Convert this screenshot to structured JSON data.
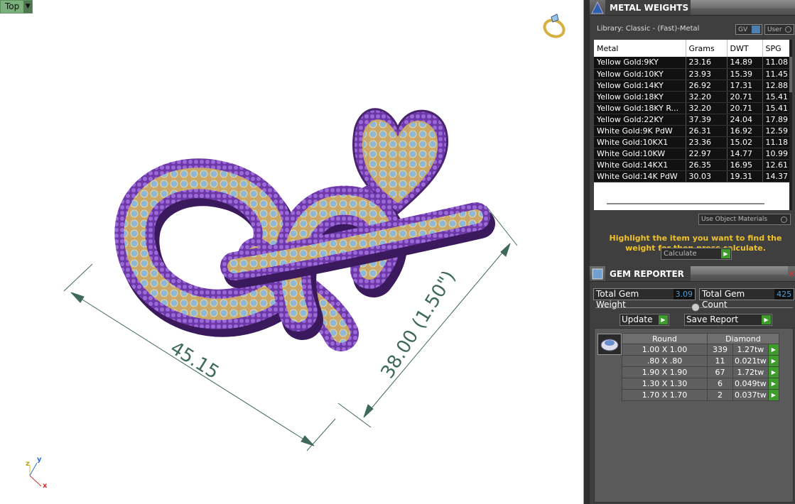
{
  "viewport": {
    "view_label": "Top",
    "dimension_horizontal": "45.15",
    "dimension_vertical": "38.00  (1.50\")",
    "axis_x": "x",
    "axis_y": "y",
    "axis_z": "z"
  },
  "metal_weights": {
    "title": "METAL WEIGHTS",
    "library": "Library: Classic - (Fast)-Metal",
    "gv_label": "GV",
    "user_label": "User",
    "columns": [
      "Metal",
      "Grams",
      "DWT",
      "SPG"
    ],
    "rows": [
      [
        "Yellow Gold:9KY",
        "23.16",
        "14.89",
        "11.08"
      ],
      [
        "Yellow Gold:10KY",
        "23.93",
        "15.39",
        "11.45"
      ],
      [
        "Yellow Gold:14KY",
        "26.92",
        "17.31",
        "12.88"
      ],
      [
        "Yellow Gold:18KY",
        "32.20",
        "20.71",
        "15.41"
      ],
      [
        "Yellow Gold:18KY R...",
        "32.20",
        "20.71",
        "15.41"
      ],
      [
        "Yellow Gold:22KY",
        "37.39",
        "24.04",
        "17.89"
      ],
      [
        "White Gold:9K PdW",
        "26.31",
        "16.92",
        "12.59"
      ],
      [
        "White Gold:10KX1",
        "23.36",
        "15.02",
        "11.18"
      ],
      [
        "White Gold:10KW",
        "22.97",
        "14.77",
        "10.99"
      ],
      [
        "White Gold:14KX1",
        "26.35",
        "16.95",
        "12.61"
      ],
      [
        "White Gold:14K PdW",
        "30.03",
        "19.31",
        "14.37"
      ]
    ],
    "use_object_materials": "Use Object Materials",
    "hint": "Highlight the item you want to find the weight for then press calculate.",
    "calculate_label": "Calculate"
  },
  "gem_reporter": {
    "title": "GEM REPORTER",
    "total_weight_label": "Total Gem Weight",
    "total_weight_value": "3.09",
    "total_count_label": "Total Gem Count",
    "total_count_value": "425",
    "update_label": "Update",
    "save_report_label": "Save Report",
    "shape_header": "Round",
    "stone_header": "Diamond",
    "rows": [
      [
        "1.00 X 1.00",
        "339",
        "1.27tw"
      ],
      [
        ".80 X .80",
        "11",
        "0.021tw"
      ],
      [
        "1.90 X 1.90",
        "67",
        "1.72tw"
      ],
      [
        "1.30 X 1.30",
        "6",
        "0.049tw"
      ],
      [
        "1.70 X 1.70",
        "2",
        "0.037tw"
      ]
    ]
  }
}
